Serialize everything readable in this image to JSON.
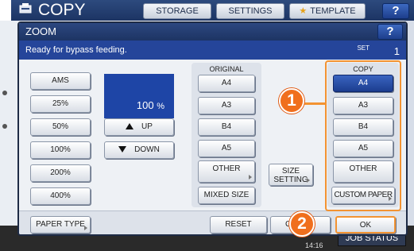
{
  "app": {
    "title": "COPY",
    "tabs": [
      {
        "label": "STORAGE"
      },
      {
        "label": "SETTINGS"
      },
      {
        "label": "TEMPLATE"
      }
    ],
    "help_label": "?"
  },
  "zoom": {
    "title": "ZOOM",
    "help_label": "?",
    "status_message": "Ready for bypass feeding.",
    "set_label": "SET",
    "set_count": "1",
    "ratio_buttons": [
      "AMS",
      "25%",
      "50%",
      "100%",
      "200%",
      "400%"
    ],
    "zoom_value": "100",
    "zoom_unit": "%",
    "up_label": "UP",
    "down_label": "DOWN",
    "original": {
      "label": "ORIGINAL",
      "sizes": [
        "A4",
        "A3",
        "B4",
        "A5"
      ],
      "other_label": "OTHER",
      "mixed_label": "MIXED SIZE",
      "selected": "A4"
    },
    "size_setting_label_1": "SIZE",
    "size_setting_label_2": "SETTING",
    "copy": {
      "label": "COPY",
      "sizes": [
        "A4",
        "A3",
        "B4",
        "A5"
      ],
      "other_label": "OTHER",
      "custom_label": "CUSTOM PAPER",
      "selected": "A4"
    },
    "paper_type_label": "PAPER TYPE",
    "reset_label": "RESET",
    "cancel_partial": "C",
    "ok_label": "OK"
  },
  "annotations": {
    "badge_1": "1",
    "badge_2": "2",
    "accent_color": "#f39332"
  },
  "footer": {
    "time": "14:16",
    "job_status_label": "JOB STATUS"
  },
  "colors": {
    "header_blue": "#1d3463",
    "status_blue": "#25459a",
    "selected_blue": "#1c3d8f"
  }
}
